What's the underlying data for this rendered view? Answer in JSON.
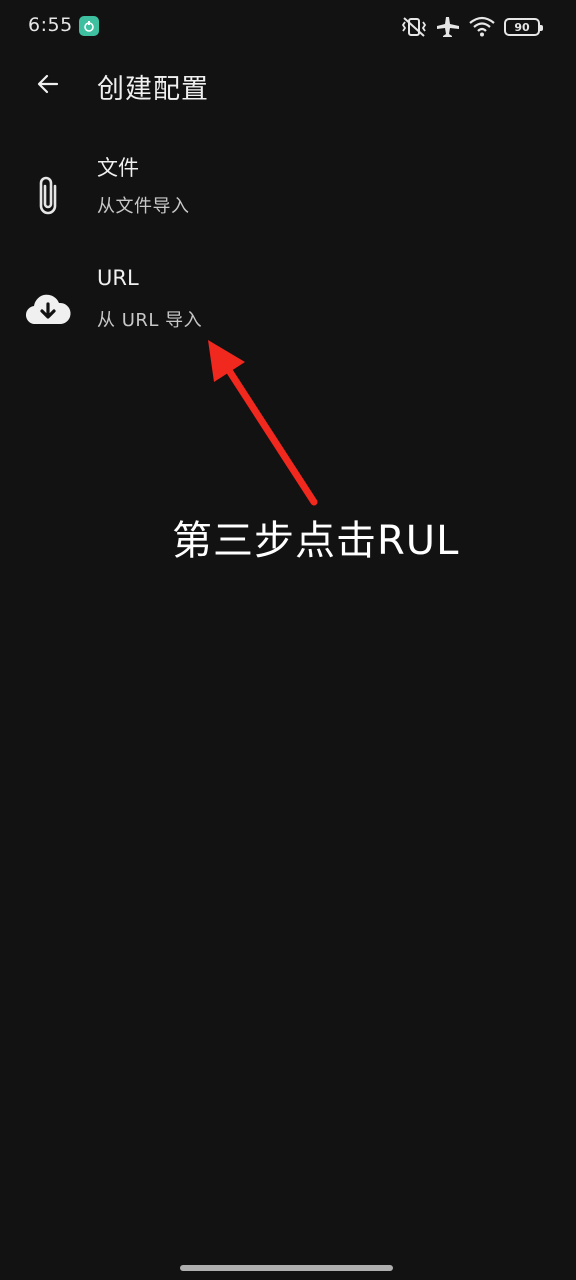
{
  "status_bar": {
    "time": "6:55",
    "battery_level": "90",
    "icons": [
      "app-notification-icon",
      "vibrate-muted-icon",
      "airplane-mode-icon",
      "wifi-icon",
      "battery-icon"
    ],
    "badge_color": "#3DBFA0"
  },
  "app_bar": {
    "back_icon": "arrow-back-icon",
    "title": "创建配置"
  },
  "list": {
    "items": [
      {
        "icon": "paperclip-icon",
        "title": "文件",
        "subtitle": "从文件导入"
      },
      {
        "icon": "cloud-download-icon",
        "title": "URL",
        "subtitle": "从 URL 导入"
      }
    ]
  },
  "annotation": {
    "text": "第三步点击RUL",
    "arrow_color": "#F0281E"
  },
  "colors": {
    "background": "#121212",
    "text_primary": "#F0F0F0",
    "text_secondary": "#C8C8C8"
  }
}
